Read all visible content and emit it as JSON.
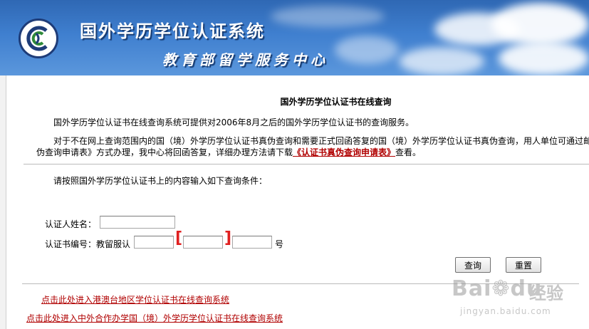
{
  "banner": {
    "title": "国外学历学位认证系统",
    "subtitle": "教育部留学服务中心",
    "logo_letters": "CSC"
  },
  "main": {
    "heading": "国外学历学位认证书在线查询",
    "para1": "国外学历学位认证书在线查询系统可提供对2006年8月之后的国外学历学位认证书的查询服务。",
    "para2": "对于不在网上查询范围内的国（境）外学历学位认证书真伪查询和需要正式回函答复的国（境）外学历学位认证书真伪查询，用人单位可通过邮",
    "para3_before": "伪查询申请表》方式办理，我中心将回函答复，详细办理方法请下载",
    "para3_link": "《认证书真伪查询申请表》",
    "para3_after": "查看。",
    "instruction": "请按照国外学历学位认证书上的内容输入如下查询条件："
  },
  "form": {
    "name_label": "认证人姓名：",
    "name_value": "",
    "cert_label": "认证书编号：教留服认",
    "cert_part1": "",
    "bracket_open": "[",
    "cert_part2": "",
    "bracket_close": "]",
    "cert_part3": "",
    "cert_suffix": "号",
    "query_button": "查询",
    "reset_button": "重置"
  },
  "links": {
    "hk_macau_taiwan": "点击此处进入港澳台地区学位认证书在线查询系统",
    "sino_foreign": "点击此处进入中外合作办学国（境）外学历学位认证书在线查询系统"
  },
  "watermark": {
    "brand": "Bai",
    "brand_tail": "du",
    "cn": "经验",
    "url": "jingyan.baidu.com"
  },
  "colors": {
    "banner_blue": "#3f7fcf",
    "link_red": "#b00000",
    "bracket_red": "#e02020"
  }
}
